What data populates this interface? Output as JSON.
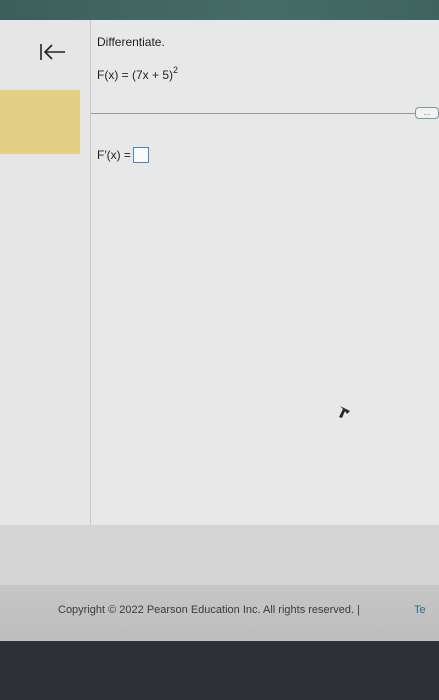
{
  "question": {
    "instruction": "Differentiate.",
    "function_lhs": "F(x) = (7x + 5)",
    "function_exponent": "2",
    "answer_label": "F′(x) =",
    "more_button_label": "..."
  },
  "footer": {
    "copyright": "Copyright © 2022 Pearson Education Inc. All rights reserved. |",
    "terms_link": "Te"
  },
  "colors": {
    "top_strip": "#466c68",
    "highlight_band": "#e3cf86",
    "answer_box_border": "#4a86c0",
    "link": "#2b6d88"
  },
  "icons": {
    "back": "arrow-left-to-bar",
    "pointer": "mouse-pointer"
  }
}
